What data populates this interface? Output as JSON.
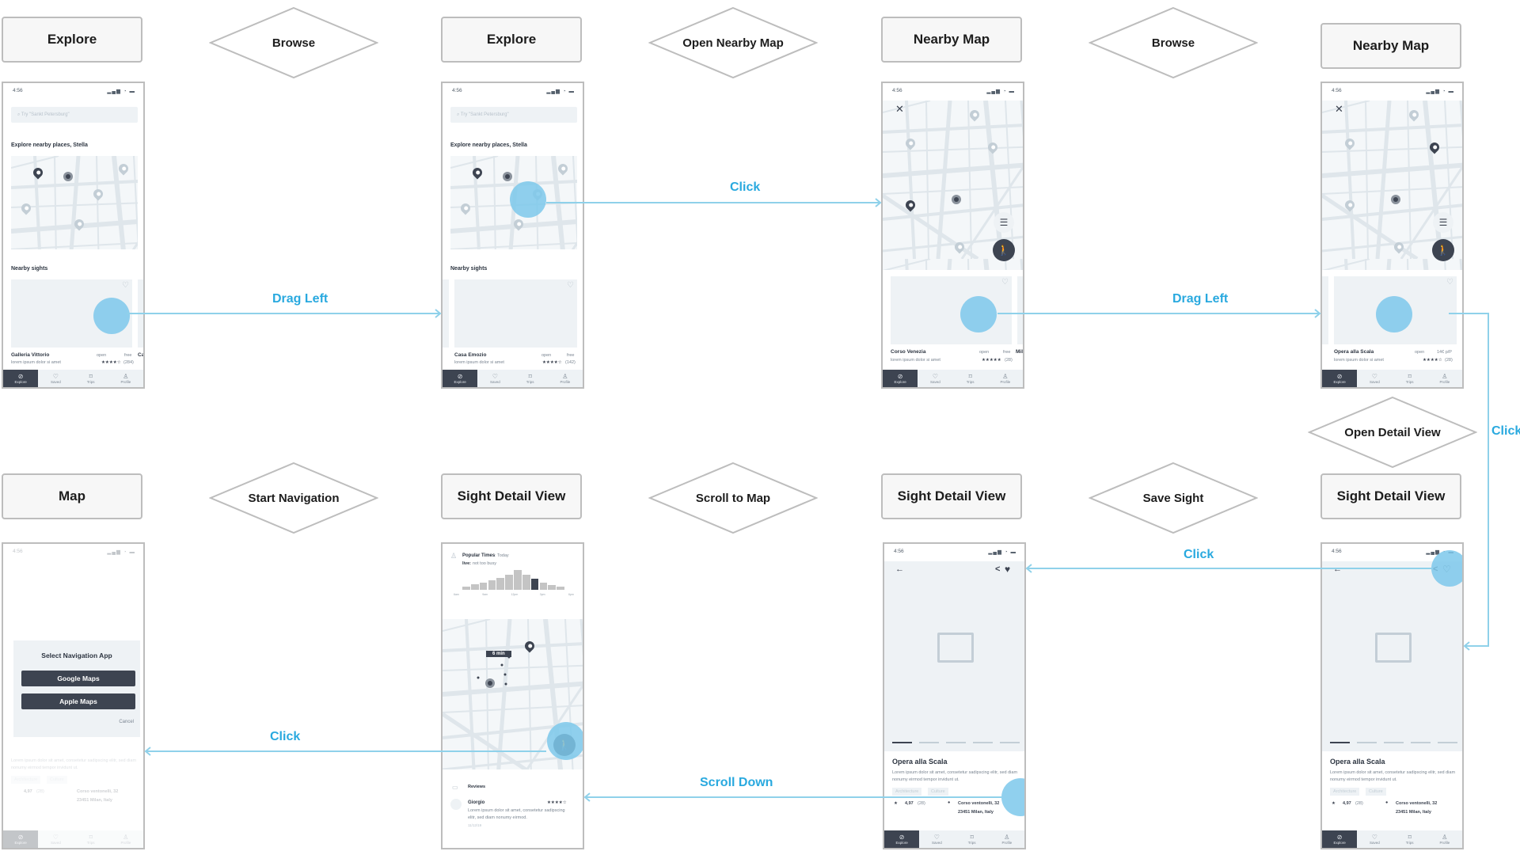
{
  "flow": {
    "screens": [
      {
        "id": "s1",
        "label": "Explore"
      },
      {
        "id": "s2",
        "label": "Explore"
      },
      {
        "id": "s3",
        "label": "Nearby Map"
      },
      {
        "id": "s4",
        "label": "Nearby Map"
      },
      {
        "id": "s5",
        "label": "Sight Detail View"
      },
      {
        "id": "s6",
        "label": "Sight Detail View"
      },
      {
        "id": "s7",
        "label": "Sight Detail View"
      },
      {
        "id": "s8",
        "label": "Map"
      }
    ],
    "decisions": [
      {
        "label": "Browse"
      },
      {
        "label": "Open Nearby Map"
      },
      {
        "label": "Browse"
      },
      {
        "label": "Open Detail View"
      },
      {
        "label": "Save Sight"
      },
      {
        "label": "Scroll to Map"
      },
      {
        "label": "Start Navigation"
      }
    ],
    "transitions": [
      {
        "label": "Drag Left",
        "from": "s1",
        "to": "s2"
      },
      {
        "label": "Click",
        "from": "s2",
        "to": "s3"
      },
      {
        "label": "Drag Left",
        "from": "s3",
        "to": "s4"
      },
      {
        "label": "Click",
        "from": "s4",
        "to": "s5"
      },
      {
        "label": "Click",
        "from": "s5",
        "to": "s6"
      },
      {
        "label": "Scroll Down",
        "from": "s6",
        "to": "s7"
      },
      {
        "label": "Click",
        "from": "s7",
        "to": "s8"
      }
    ],
    "accent_color": "#29a9df"
  },
  "status": {
    "time": "4:56",
    "icons": "signal wifi battery"
  },
  "explore": {
    "search_placeholder": "Try \"Sankt Petersburg\"",
    "heading": "Explore nearby places, Stella",
    "nearby_heading": "Nearby sights",
    "cards": [
      {
        "name": "Galleria Vittorio",
        "status": "open",
        "price": "free",
        "desc": "lorem ipsum dolor si amet",
        "rating": "★★★★☆",
        "count": "(284)"
      },
      {
        "name": "Casa Emozio",
        "status": "open",
        "price": "free",
        "desc": "lorem ipsum dolor si amet",
        "rating": "★★★★☆",
        "count": "(142)"
      },
      {
        "name": "Corso Venezia",
        "status": "open",
        "price": "free",
        "desc": "lorem ipsum dolor si amet",
        "rating": "★★★★★",
        "count": "(28)"
      },
      {
        "name": "Opera alla Scala",
        "status": "open",
        "price": "14€ p/P",
        "desc": "lorem ipsum dolor si amet",
        "rating": "★★★★☆",
        "count": "(28)"
      }
    ],
    "peek_next": [
      "Ca",
      "Mil"
    ]
  },
  "tabs": [
    {
      "label": "Explore",
      "glyph": "⊘"
    },
    {
      "label": "Saved",
      "glyph": "♡"
    },
    {
      "label": "Trips",
      "glyph": "⌑"
    },
    {
      "label": "Profile",
      "glyph": "♙"
    }
  ],
  "map_icons": {
    "close": "✕",
    "filter": "☰",
    "walk": "🚶"
  },
  "detail": {
    "title": "Opera alla Scala",
    "desc": "Lorem ipsum dolor sit amet, consetetur sadipscing elitr, sed diam nonumy eirmod tempor invidunt ut.",
    "tags": [
      "Architecture",
      "Culture"
    ],
    "rating": "4,97",
    "rating_count": "(28)",
    "address_line1": "Corso ventonelli, 32",
    "address_line2": "23451 Milan, Italy",
    "back": "←",
    "share": "<",
    "heart_empty": "♡",
    "heart_full": "♥"
  },
  "popular": {
    "title": "Popular Times",
    "day": ": Today",
    "live_label": "live:",
    "live_text": "not too busy",
    "bars": [
      0.18,
      0.28,
      0.38,
      0.5,
      0.62,
      0.78,
      1.0,
      0.75,
      0.55,
      0.35,
      0.25,
      0.15
    ],
    "current_index": 8,
    "ticks": [
      "6am",
      "9am",
      "12pm",
      "3pm",
      "6pm"
    ]
  },
  "route": {
    "eta": "6 min"
  },
  "reviews": {
    "title": "Reviews",
    "author": "Giorgio",
    "stars": "★★★★☆",
    "text": "Lorem ipsum dolor sit amet, consetetur sadipscing elitr, sed diam nonumy eirmod.",
    "date": "11/12/19"
  },
  "nav_dialog": {
    "title": "Select Navigation App",
    "options": [
      "Google Maps",
      "Apple Maps"
    ],
    "cancel": "Cancel"
  }
}
